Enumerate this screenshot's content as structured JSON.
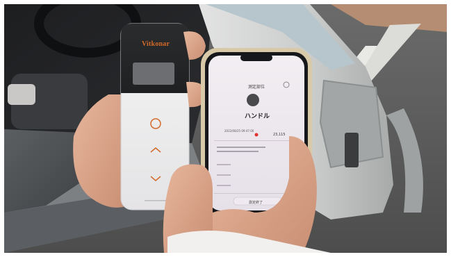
{
  "device": {
    "brand": "Vitkonar",
    "brand_mark": "registered-mark-icon"
  },
  "phone_app": {
    "header_title": "測定部位",
    "part_name": "ハンドル",
    "reading_date": "2022/08/25 09:47:00",
    "reading_value": "23,115",
    "bottom_button": "測定終了"
  },
  "colors": {
    "device_accent": "#d36a28",
    "alert_red": "#e0322e",
    "phone_case": "#d8c9a9",
    "sky": "#b6c6cc"
  }
}
